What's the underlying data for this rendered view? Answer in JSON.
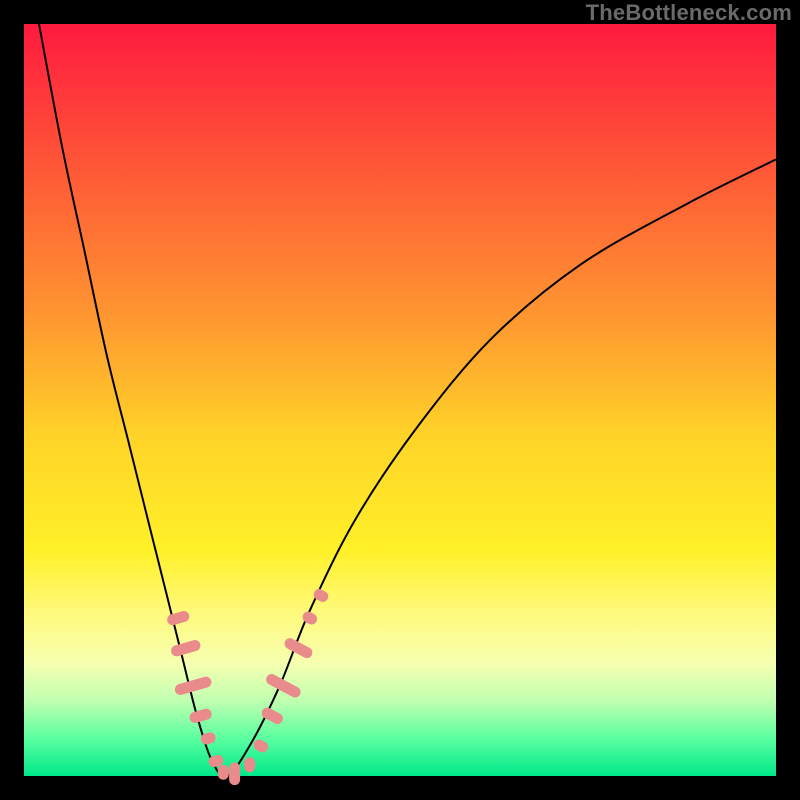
{
  "watermark": "TheBottleneck.com",
  "chart_data": {
    "type": "line",
    "title": "",
    "xlabel": "",
    "ylabel": "",
    "xlim": [
      0,
      100
    ],
    "ylim": [
      0,
      100
    ],
    "background": {
      "gradient_stops": [
        {
          "pos": 0,
          "color": "#ff1a3f"
        },
        {
          "pos": 10,
          "color": "#ff3a3a"
        },
        {
          "pos": 25,
          "color": "#ff6a35"
        },
        {
          "pos": 40,
          "color": "#ff9a30"
        },
        {
          "pos": 55,
          "color": "#ffd428"
        },
        {
          "pos": 70,
          "color": "#fff028"
        },
        {
          "pos": 78,
          "color": "#fff97a"
        },
        {
          "pos": 85,
          "color": "#f6ffb0"
        },
        {
          "pos": 90,
          "color": "#c0ffb0"
        },
        {
          "pos": 95,
          "color": "#5affa0"
        },
        {
          "pos": 100,
          "color": "#00e88a"
        }
      ]
    },
    "series": [
      {
        "name": "bottleneck-curve",
        "color": "#000000",
        "stroke_width": 2,
        "x": [
          2,
          5,
          8,
          11,
          14,
          17,
          19,
          21,
          23,
          25,
          27,
          30,
          34,
          38,
          44,
          52,
          62,
          74,
          88,
          100
        ],
        "y": [
          100,
          84,
          70,
          56,
          44,
          32,
          24,
          16,
          8,
          2,
          0,
          4,
          12,
          22,
          34,
          46,
          58,
          68,
          76,
          82
        ]
      }
    ],
    "markers": [
      {
        "name": "left-branch-dots",
        "shape": "rounded",
        "color": "#e98b8b",
        "points": [
          {
            "x": 20.5,
            "y": 21,
            "len": 3
          },
          {
            "x": 21.5,
            "y": 17,
            "len": 4
          },
          {
            "x": 22.5,
            "y": 12,
            "len": 5
          },
          {
            "x": 23.5,
            "y": 8,
            "len": 3
          },
          {
            "x": 24.5,
            "y": 5,
            "len": 2
          },
          {
            "x": 25.5,
            "y": 2,
            "len": 2
          }
        ]
      },
      {
        "name": "valley-dots",
        "shape": "rounded",
        "color": "#e98b8b",
        "points": [
          {
            "x": 26.5,
            "y": 0.5,
            "len": 2
          },
          {
            "x": 28.0,
            "y": 0.3,
            "len": 3
          },
          {
            "x": 30.0,
            "y": 1.5,
            "len": 2
          }
        ]
      },
      {
        "name": "right-branch-dots",
        "shape": "rounded",
        "color": "#e98b8b",
        "points": [
          {
            "x": 31.5,
            "y": 4,
            "len": 2
          },
          {
            "x": 33.0,
            "y": 8,
            "len": 3
          },
          {
            "x": 34.5,
            "y": 12,
            "len": 5
          },
          {
            "x": 36.5,
            "y": 17,
            "len": 4
          },
          {
            "x": 38.0,
            "y": 21,
            "len": 2
          },
          {
            "x": 39.5,
            "y": 24,
            "len": 2
          }
        ]
      }
    ]
  }
}
